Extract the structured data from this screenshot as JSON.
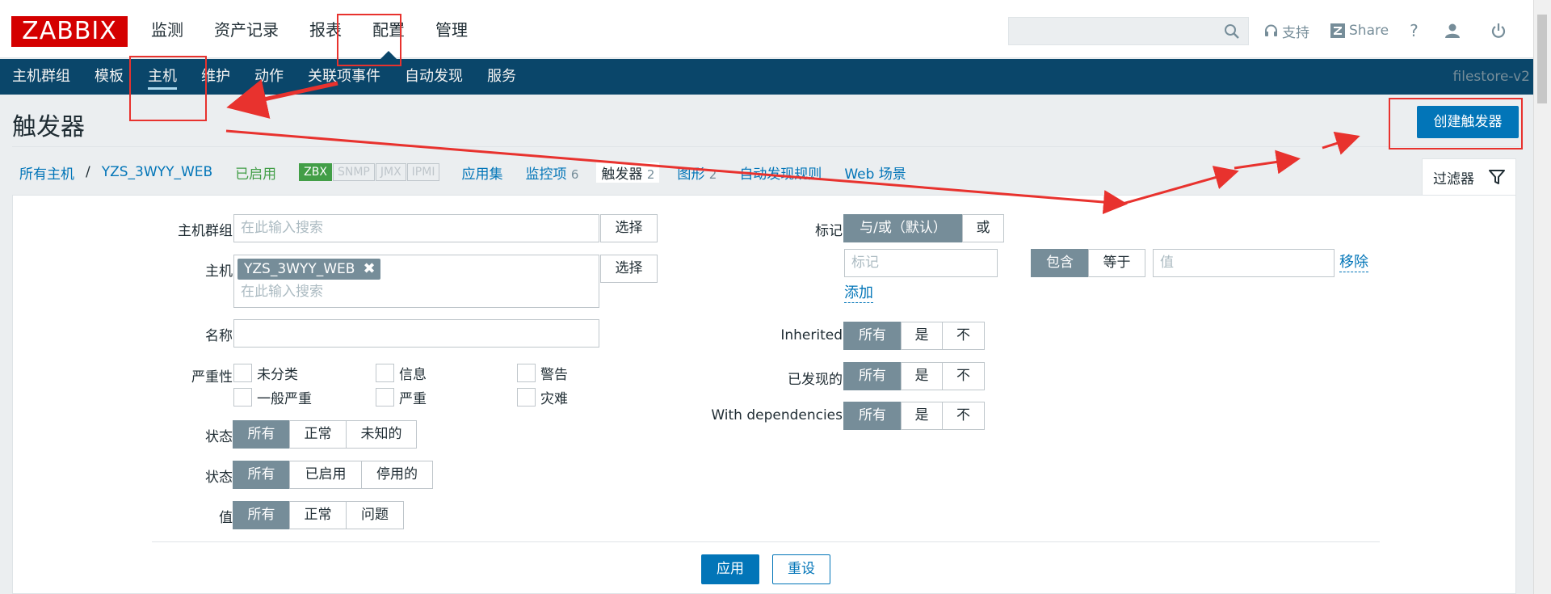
{
  "header": {
    "logo": "ZABBIX",
    "menu": [
      "监测",
      "资产记录",
      "报表",
      "配置",
      "管理"
    ],
    "selected_menu_index": 3,
    "tools": {
      "support": "支持",
      "share": "Share",
      "help": "?"
    }
  },
  "nav": {
    "items": [
      "主机群组",
      "模板",
      "主机",
      "维护",
      "动作",
      "关联项事件",
      "自动发现",
      "服务"
    ],
    "active_index": 2,
    "server_name": "filestore-v2"
  },
  "page": {
    "title": "触发器",
    "create_button": "创建触发器"
  },
  "breadcrumb": {
    "all_hosts": "所有主机",
    "separator": "/",
    "host": "YZS_3WYY_WEB",
    "status": "已启用",
    "availability": [
      "ZBX",
      "SNMP",
      "JMX",
      "IPMI"
    ],
    "tabs": [
      {
        "label": "应用集",
        "count": ""
      },
      {
        "label": "监控项",
        "count": "6"
      },
      {
        "label": "触发器",
        "count": "2"
      },
      {
        "label": "图形",
        "count": "2"
      },
      {
        "label": "自动发现规则",
        "count": ""
      },
      {
        "label": "Web 场景",
        "count": ""
      }
    ]
  },
  "filter": {
    "tab_label": "过滤器",
    "host_group_label": "主机群组",
    "host_group_placeholder": "在此输入搜索",
    "select_button": "选择",
    "host_label": "主机",
    "host_chip": "YZS_3WYY_WEB",
    "host_placeholder": "在此输入搜索",
    "name_label": "名称",
    "name_value": "",
    "severity_label": "严重性",
    "severities": [
      "未分类",
      "信息",
      "警告",
      "一般严重",
      "严重",
      "灾难"
    ],
    "state_label": "状态",
    "state_options": [
      "所有",
      "正常",
      "未知的"
    ],
    "status_label": "状态",
    "status_options": [
      "所有",
      "已启用",
      "停用的"
    ],
    "value_label": "值",
    "value_options": [
      "所有",
      "正常",
      "问题"
    ],
    "tags_label": "标记",
    "tags_mode": [
      "与/或（默认）",
      "或"
    ],
    "tag_placeholder": "标记",
    "tag_operator": [
      "包含",
      "等于"
    ],
    "tag_value_placeholder": "值",
    "remove_link": "移除",
    "add_link": "添加",
    "inherited_label": "Inherited",
    "discovered_label": "已发现的",
    "dependencies_label": "With dependencies",
    "tri_options": [
      "所有",
      "是",
      "不"
    ],
    "apply_button": "应用",
    "reset_button": "重设"
  },
  "colors": {
    "brand_red": "#d40000",
    "nav_bg": "#0a466a",
    "primary": "#0275b8",
    "segment_on": "#768d99",
    "enabled_green": "#429e47",
    "annotation_red": "#e8322e"
  }
}
